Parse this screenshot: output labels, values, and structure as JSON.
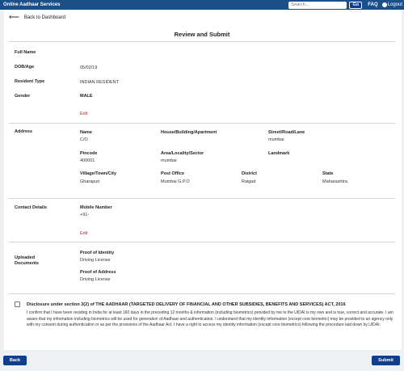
{
  "topbar": {
    "title": "Online Aadhaar Services",
    "search_placeholder": "Search...",
    "go_label": "Go",
    "faq_label": "FAQ",
    "logout_label": "Logout"
  },
  "nav": {
    "back_to_dashboard": "Back to Dashboard"
  },
  "page": {
    "title": "Review and Submit"
  },
  "personal": {
    "full_name_label": "Full Name",
    "dob_label": "DOB/Age",
    "dob_value": "05/02/19",
    "resident_type_label": "Resident Type",
    "resident_type_value": "INDIAN RESIDENT",
    "gender_label": "Gender",
    "gender_value": "MALE",
    "edit_label": "Edit"
  },
  "address": {
    "section_label": "Address",
    "name_label": "Name",
    "name_value": "C/O",
    "house_label": "House/Building/Apartment",
    "street_label": "Street/Road/Lane",
    "street_value": "mumbai",
    "pincode_label": "Pincode",
    "pincode_value": "400001",
    "area_label": "Area/Locality/Sector",
    "area_value": "mumbai",
    "landmark_label": "Landmark",
    "village_label": "Village/Town/City",
    "village_value": "Gharapuri",
    "post_office_label": "Post Office",
    "post_office_value": "Mumbai G.P.O",
    "district_label": "District",
    "district_value": "Raigad",
    "state_label": "State",
    "state_value": "Maharashtra"
  },
  "contact": {
    "section_label": "Contact Details",
    "mobile_label": "Mobile Number",
    "mobile_value": "+91-",
    "edit_label": "Edit"
  },
  "documents": {
    "section_label_line1": "Uploaded",
    "section_label_line2": "Documents",
    "poi_label": "Proof of Identity",
    "poi_value": "Driving License",
    "poa_label": "Proof of Address",
    "poa_value": "Driving License"
  },
  "disclosure": {
    "heading": "Disclosure under section 3(2) of THE AADHAAR (TARGETED DELIVERY OF FINANCIAL AND OTHER SUBSIDIES, BENEFITS AND SERVICES) ACT, 2016",
    "text": "I confirm that I have been residing in India for at least 182 days in the preceding 12 months & information (including biometrics) provided by me to the UIDAI is my own and is true, correct and accurate. I am aware that my information including biometrics will be used for generation of Aadhaar and authentication. I understand that my identity information (except core biometric) may be provided to an agency only with my consent during authentication or as per the provisions of the Aadhaar Act. I have a right to access my identity information (except core biometrics) following the procedure laid down by UIDAI."
  },
  "footer": {
    "back_label": "Back",
    "submit_label": "Submit"
  }
}
